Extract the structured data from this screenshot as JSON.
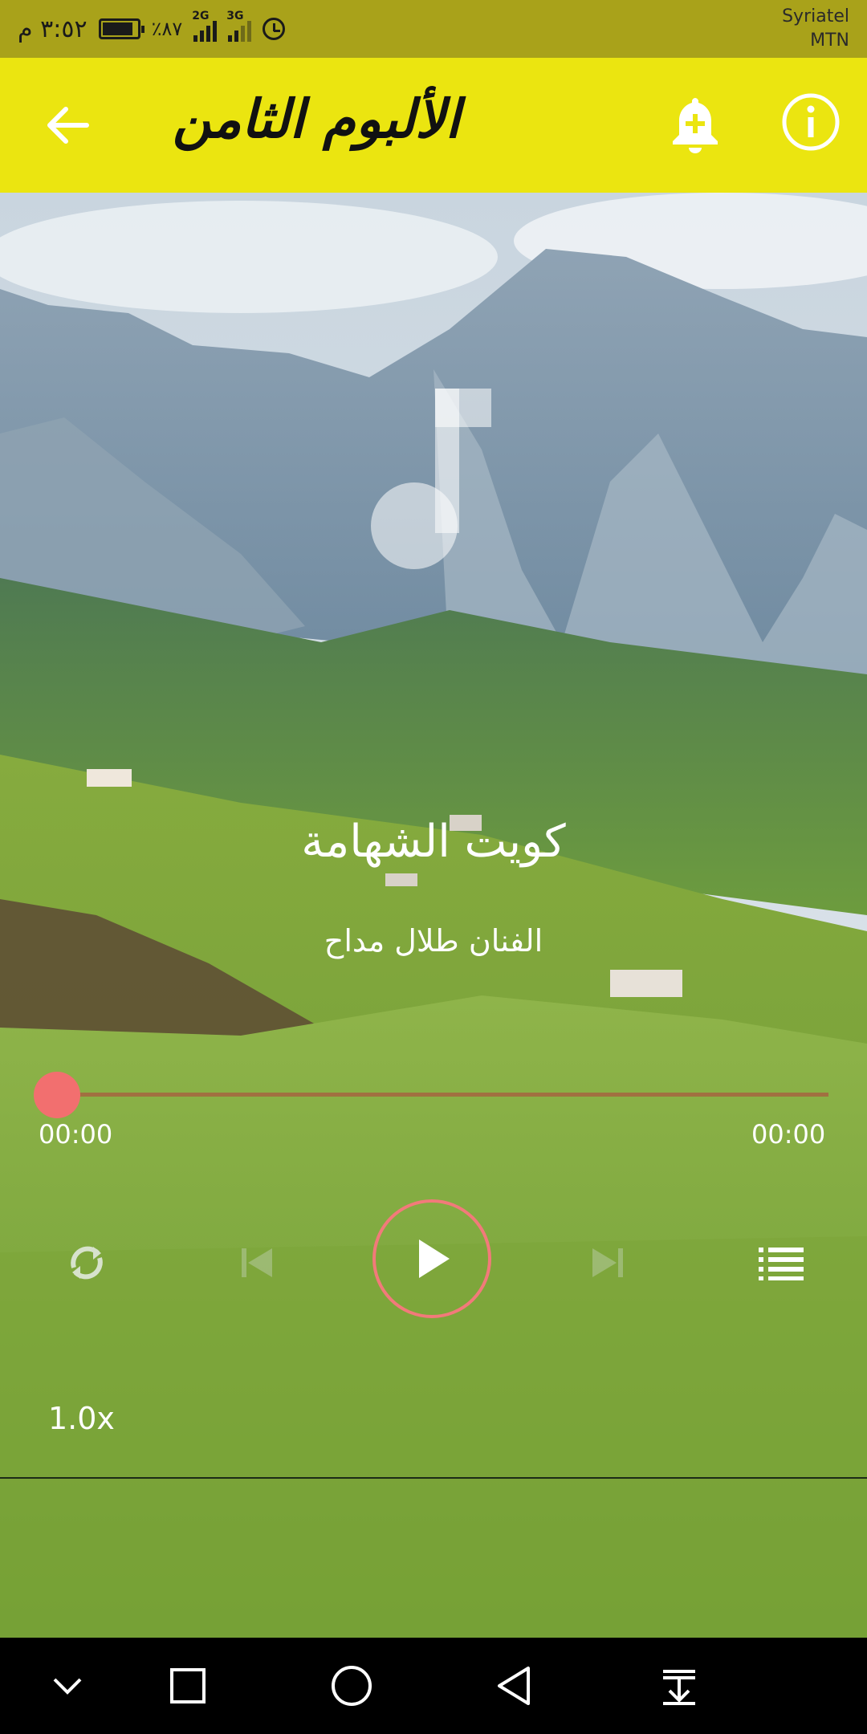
{
  "status_bar": {
    "time": "٣:٥٢ م",
    "battery": "٪٨٧",
    "network1": "2G",
    "network2": "3G",
    "carrier_line1": "Syriatel",
    "carrier_line2": "MTN"
  },
  "app_bar": {
    "title": "الألبوم الثامن",
    "back_icon": "arrow-left-icon",
    "bell_icon": "bell-plus-icon",
    "info_icon": "info-icon"
  },
  "player": {
    "track_title": "كويت الشهامة",
    "artist": "الفنان طلال مداح",
    "current_time": "00:00",
    "duration": "00:00",
    "progress": 0,
    "speed": "1.0x",
    "controls": [
      "repeat-icon",
      "skip-previous-icon",
      "play-icon",
      "skip-next-icon",
      "playlist-icon"
    ]
  },
  "colors": {
    "status_bar": "#a9a21a",
    "app_bar": "#ebe510",
    "accent": "#f26f6f"
  },
  "nav_bar": {
    "buttons": [
      "chevron-down-icon",
      "square-icon",
      "circle-home-icon",
      "triangle-back-icon",
      "download-arrow-icon"
    ]
  }
}
